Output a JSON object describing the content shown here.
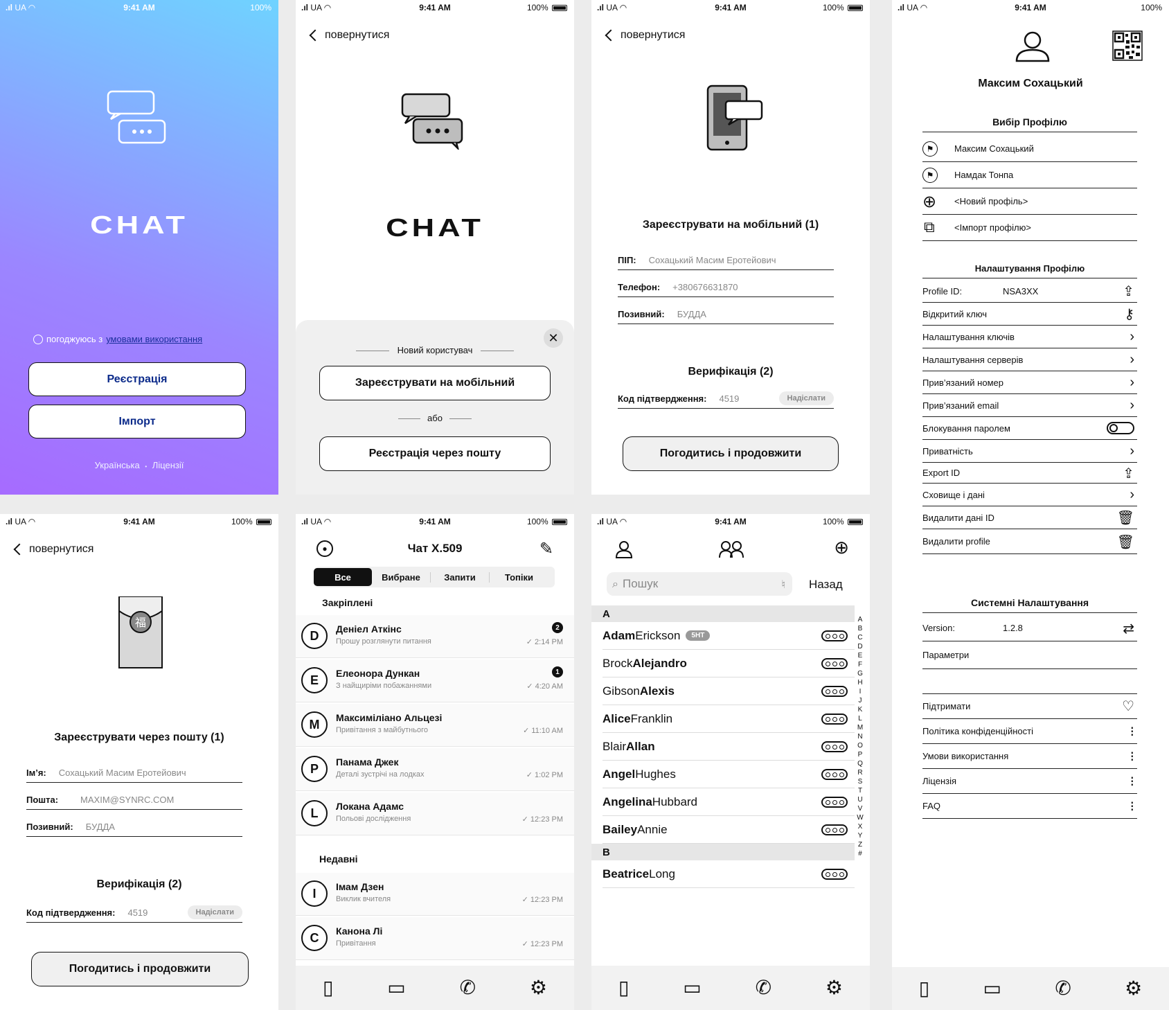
{
  "status": {
    "carrier": "UA",
    "time": "9:41 AM",
    "battery": "100%"
  },
  "common": {
    "back": "повернутися",
    "send": "Надіслати",
    "agree": "Погодитись і продовжити"
  },
  "splash": {
    "brand": "CHAT",
    "agree_prefix": "погоджуюсь з",
    "agree_link": "умовами використання",
    "register": "Реєстрація",
    "import": "Імпорт",
    "lang": "Українська",
    "dot": "•",
    "licenses": "Ліцензії"
  },
  "newuser": {
    "brand": "CHAT",
    "section": "Новий користувач",
    "mobile": "Зареєструвати на мобільний",
    "or": "або",
    "email": "Реєстрація через пошту"
  },
  "mobilereg": {
    "title": "Зареєструвати на мобільний (1)",
    "name_label": "ПІП:",
    "name_value": "Сохацький Масим Еротейович",
    "phone_label": "Телефон:",
    "phone_value": "+380676631870",
    "nick_label": "Позивний:",
    "nick_value": "БУДДА",
    "verify_title": "Верифікація (2)",
    "code_label": "Код підтвердження:",
    "code_value": "4519"
  },
  "profile": {
    "name": "Максим Сохацький",
    "choose_title": "Вибір Профілю",
    "profiles": [
      "Максим Сохацький",
      "Намдак Тонпа",
      "<Новий профіль>",
      "<Імпорт профілю>"
    ],
    "settings_title": "Налаштування Профілю",
    "id_label": "Profile ID:",
    "id_value": "NSA3XX",
    "settings": [
      "Відкритий ключ",
      "Налаштування ключів",
      "Налаштування серверів",
      "Прив’язаний номер",
      "Прив’язаний email",
      "Блокування паролем",
      "Приватність",
      "Export ID",
      "Сховище і дані",
      "Видалити дані ID",
      "Видалити profile"
    ],
    "system_title": "Системні Налаштування",
    "version_label": "Version:",
    "version_value": "1.2.8",
    "params": "Параметри",
    "support": [
      "Підтримати",
      "Політика конфіденційності",
      "Умови використання",
      "Ліцензія",
      "FAQ"
    ]
  },
  "emailreg": {
    "title": "Зареєструвати через пошту (1)",
    "name_label": "Ім’я:",
    "name_value": "Сохацький Масим Еротейович",
    "mail_label": "Пошта:",
    "mail_value": "MAXIM@SYNRC.COM",
    "nick_label": "Позивний:",
    "nick_value": "БУДДА",
    "verify_title": "Верифікація (2)",
    "code_label": "Код підтвердження:",
    "code_value": "4519"
  },
  "chats": {
    "title": "Чат X.509",
    "filters": [
      "Все",
      "Вибране",
      "Запити",
      "Топіки"
    ],
    "pinned_title": "Закріплені",
    "pinned": [
      {
        "letter": "D",
        "name": "Деніел Аткінс",
        "preview": "Прошу розглянути питання",
        "time": "2:14 PM",
        "badge": "2"
      },
      {
        "letter": "E",
        "name": "Елеонора Дункан",
        "preview": "З найщиріми побажаннями",
        "time": "4:20 AM",
        "badge": "1"
      },
      {
        "letter": "M",
        "name": "Максиміліано Альцезі",
        "preview": "Привітання з майбутнього",
        "time": "11:10 AM",
        "badge": ""
      },
      {
        "letter": "P",
        "name": "Панама Джек",
        "preview": "Деталі зустрічі на лодках",
        "time": "1:02 PM",
        "badge": ""
      },
      {
        "letter": "L",
        "name": "Локана Адамс",
        "preview": "Польові дослідження",
        "time": "12:23 PM",
        "badge": ""
      }
    ],
    "recent_title": "Недавні",
    "recent": [
      {
        "letter": "I",
        "name": "Імам Дзен",
        "preview": "Виклик вчителя",
        "time": "12:23 PM",
        "badge": ""
      },
      {
        "letter": "C",
        "name": "Канона Лі",
        "preview": "Привітання",
        "time": "12:23 PM",
        "badge": ""
      }
    ]
  },
  "contacts": {
    "search_placeholder": "Пошук",
    "cancel": "Назад",
    "sections": [
      {
        "letter": "A",
        "items": [
          {
            "first": "Adam",
            "last": "Erickson",
            "tag": "5НТ",
            "bold": "first"
          },
          {
            "first": "Brock",
            "last": "Alejandro",
            "tag": "",
            "bold": "last"
          },
          {
            "first": "Gibson",
            "last": "Alexis",
            "tag": "",
            "bold": "last"
          },
          {
            "first": "Alice",
            "last": "Franklin",
            "tag": "",
            "bold": "first"
          },
          {
            "first": "Blair",
            "last": "Allan",
            "tag": "",
            "bold": "last"
          },
          {
            "first": "Angel",
            "last": "Hughes",
            "tag": "",
            "bold": "first"
          },
          {
            "first": "Angelina",
            "last": "Hubbard",
            "tag": "",
            "bold": "first"
          },
          {
            "first": "Bailey",
            "last": "Annie",
            "tag": "",
            "bold": "first"
          }
        ]
      },
      {
        "letter": "B",
        "items": [
          {
            "first": "Beatrice",
            "last": "Long",
            "tag": "",
            "bold": "first"
          }
        ]
      }
    ],
    "index": [
      "A",
      "B",
      "C",
      "D",
      "E",
      "F",
      "G",
      "H",
      "I",
      "J",
      "K",
      "L",
      "M",
      "N",
      "O",
      "P",
      "Q",
      "R",
      "S",
      "T",
      "U",
      "V",
      "W",
      "X",
      "Y",
      "Z",
      "#"
    ]
  },
  "icons": {
    "chat": "chat-bubbles-icon",
    "contacts": "contacts-icon",
    "phone": "phone-icon",
    "settings": "gear-icon"
  },
  "colors": {
    "grad_a": "#8f6bff",
    "grad_b": "#6fd3ff",
    "brand_blue": "#0b2a8a"
  }
}
